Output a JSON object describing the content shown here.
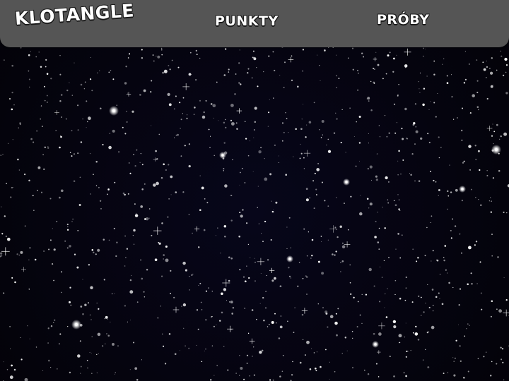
{
  "game": {
    "title": "KLOTANGLE"
  },
  "hud": {
    "score_label": "PUNKTY",
    "attempts_label": "PRÓBY"
  },
  "colors": {
    "hud_background": "#555555",
    "sky_background": "#04030f",
    "star": "#ffffff",
    "hud_text": "#ffffff",
    "hud_text_outline": "#1a1a1a"
  },
  "scene": {
    "background": "starfield"
  }
}
